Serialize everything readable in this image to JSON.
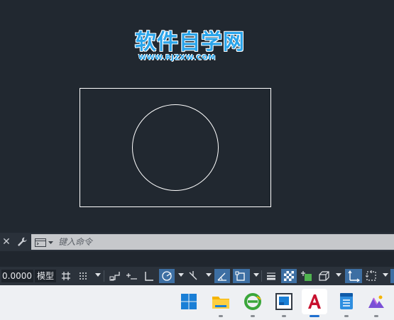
{
  "watermark": {
    "title": "软件自学网",
    "url": "WWW.RJZXW.COM"
  },
  "command_line": {
    "close": "✕",
    "placeholder": "键入命令"
  },
  "status_bar": {
    "coordinates": "0.0000",
    "model_label": "模型"
  },
  "icons": {
    "close": "close-icon",
    "customize": "wrench-icon",
    "history": "command-history-icon",
    "grid": "grid-icon",
    "snap": "snap-grid-icon",
    "infer": "infer-constraints-icon",
    "dynamic_input": "dynamic-input-icon",
    "ortho": "ortho-icon",
    "polar": "polar-tracking-icon",
    "isodraft": "isometric-icon",
    "object_snap_track": "object-snap-tracking-icon",
    "object_snap": "object-snap-icon",
    "lineweight": "lineweight-icon",
    "transparency": "transparency-icon",
    "selection_cycling": "selection-cycling-icon",
    "3d_osnap": "3d-object-snap-icon",
    "ucs": "dynamic-ucs-icon",
    "gizmo": "gizmo-icon"
  },
  "taskbar": {
    "apps": [
      "windows-start-icon",
      "file-explorer-icon",
      "browser-icon",
      "image-viewer-icon",
      "autocad-icon",
      "notepad-icon",
      "app-icon"
    ]
  },
  "colors": {
    "canvas": "#212830",
    "geometry": "#ffffff",
    "watermark": "#2aa4ea",
    "active_toggle": "#3d6fa3",
    "autocad_red": "#c8102e"
  }
}
